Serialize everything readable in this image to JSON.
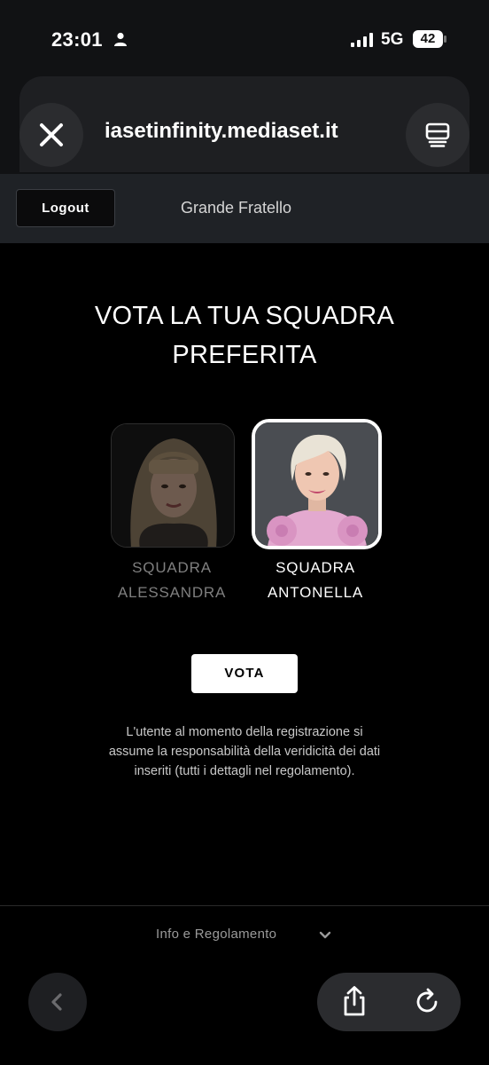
{
  "status_bar": {
    "time": "23:01",
    "network": "5G",
    "battery": "42"
  },
  "browser": {
    "url": "iasetinfinity.mediaset.it"
  },
  "site_header": {
    "logout_label": "Logout",
    "title": "Grande Fratello"
  },
  "main": {
    "heading_line1": "VOTA LA TUA SQUADRA",
    "heading_line2": "PREFERITA",
    "teams": [
      {
        "line1": "SQUADRA",
        "line2": "ALESSANDRA",
        "selected": false
      },
      {
        "line1": "SQUADRA",
        "line2": "ANTONELLA",
        "selected": true
      }
    ],
    "vote_label": "VOTA",
    "disclaimer_line1": "L'utente al momento della registrazione si",
    "disclaimer_line2": "assume la responsabilità della veridicità dei dati",
    "disclaimer_line3": "inseriti (tutti i dettagli nel regolamento)."
  },
  "footer": {
    "info_label": "Info e Regolamento"
  },
  "icons": {
    "close": "close-icon",
    "tabs": "tabs-icon",
    "back": "chevron-left-icon",
    "share": "share-icon",
    "reload": "reload-icon",
    "info_toggle": "chevron-down-icon"
  },
  "colors": {
    "background": "#000000",
    "header": "#1f2226",
    "vote_button": "#ffffff"
  }
}
